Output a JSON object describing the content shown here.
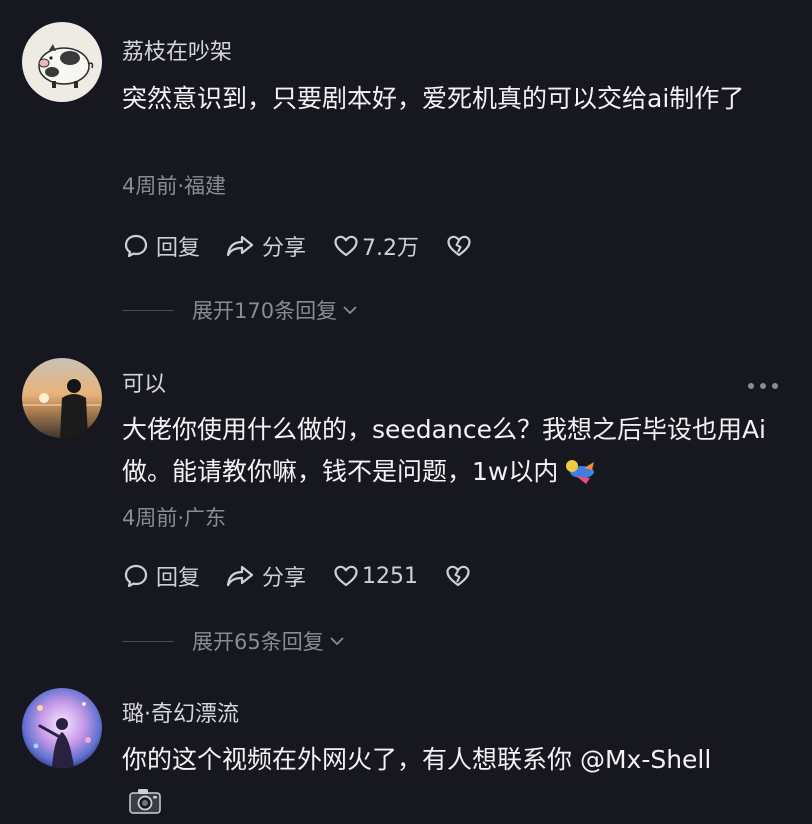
{
  "comments": [
    {
      "username": "荔枝在吵架",
      "text": "突然意识到，只要剧本好，爱死机真的可以交给ai制作了",
      "meta": "4周前·福建",
      "reply_label": "回复",
      "share_label": "分享",
      "likes": "7.2万",
      "expand_label": "展开170条回复"
    },
    {
      "username": "可以",
      "text": "大佬你使用什么做的，seedance么？我想之后毕设也用Ai做。能请教你嘛，钱不是问题，1w以内",
      "meta": "4周前·广东",
      "reply_label": "回复",
      "share_label": "分享",
      "likes": "1251",
      "expand_label": "展开65条回复"
    },
    {
      "username": "璐·奇幻漂流",
      "text": "你的这个视频在外网火了，有人想联系你 @Mx-Shell"
    }
  ],
  "icons": {
    "reply": "comment-bubble-icon",
    "share": "share-arrow-icon",
    "like": "heart-outline-icon",
    "dislike": "broken-heart-icon",
    "expand": "chevron-down-icon",
    "more": "more-dots-icon",
    "camera": "camera-icon"
  },
  "colors": {
    "background": "#16171f",
    "text_primary": "#f3f3f5",
    "text_secondary": "#8a8b93"
  }
}
